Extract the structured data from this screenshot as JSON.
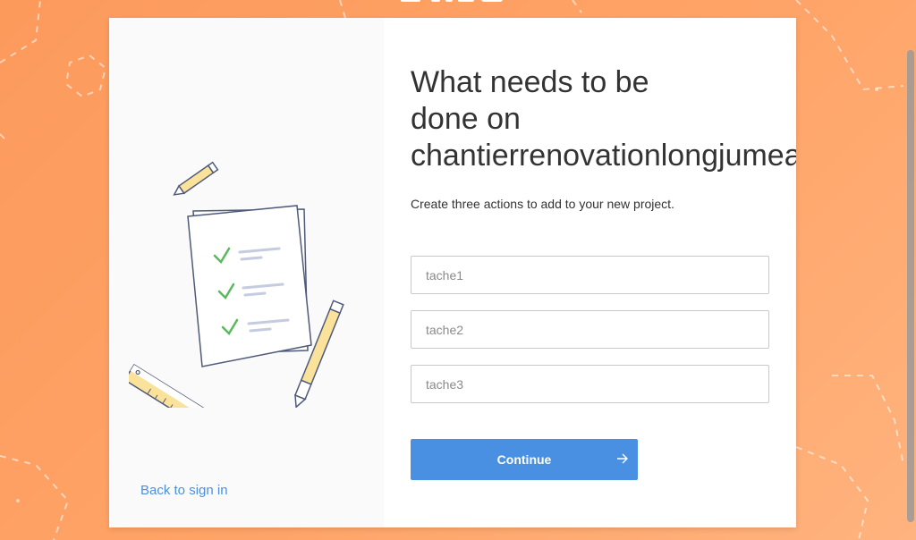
{
  "header": {
    "logo_icon": "app-logo-icon"
  },
  "left_panel": {
    "illustration_icon": "task-checklist-illustration",
    "back_link": "Back to sign in"
  },
  "main": {
    "title": "What needs to be\ndone on\nchantierrenovationlongjumeau?",
    "subtitle": "Create three actions to add to your new project.",
    "tasks": [
      {
        "placeholder": "tache1"
      },
      {
        "placeholder": "tache2"
      },
      {
        "placeholder": "tache3"
      }
    ],
    "continue_label": "Continue",
    "continue_icon": "arrow-right-icon"
  },
  "colors": {
    "background": "#fc9a5c",
    "accent": "#4a90e2",
    "check": "#5cb85c"
  }
}
